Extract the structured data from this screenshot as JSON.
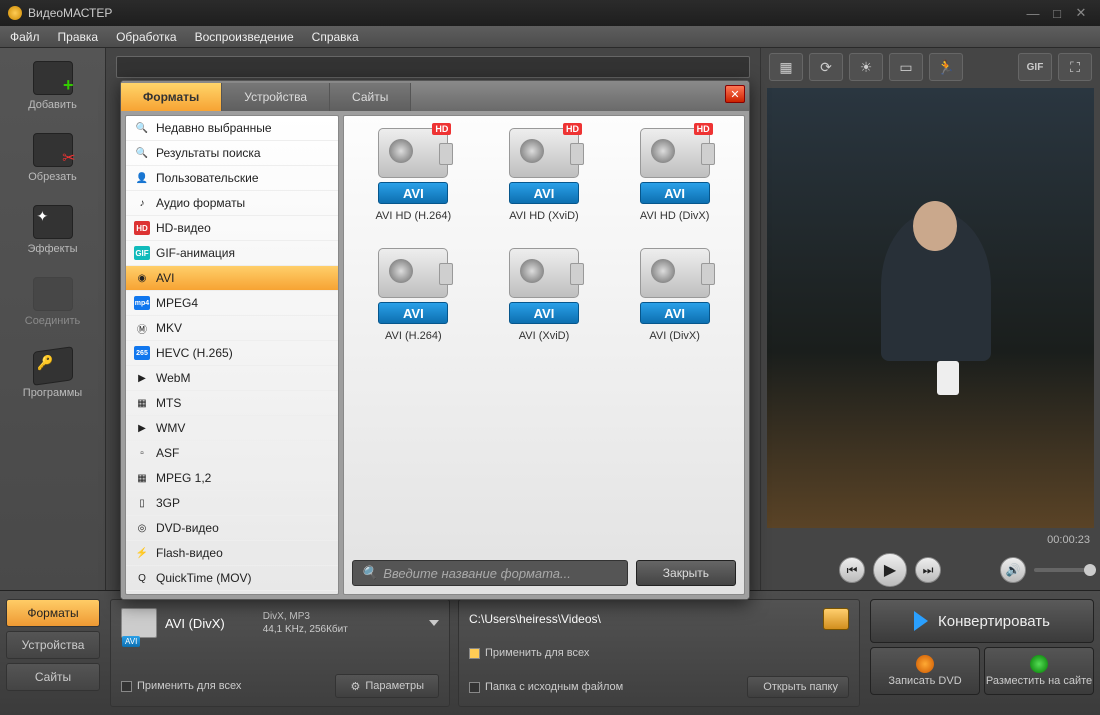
{
  "appTitle": "ВидеоМАСТЕР",
  "menu": [
    "Файл",
    "Правка",
    "Обработка",
    "Воспроизведение",
    "Справка"
  ],
  "sidebar": [
    {
      "label": "Добавить"
    },
    {
      "label": "Обрезать"
    },
    {
      "label": "Эффекты"
    },
    {
      "label": "Соединить"
    },
    {
      "label": "Программы"
    }
  ],
  "preview": {
    "time": "00:00:23",
    "gifLabel": "GIF"
  },
  "bottomTabs": [
    "Форматы",
    "Устройства",
    "Сайты"
  ],
  "codec": {
    "name": "AVI (DivX)",
    "tag": "AVI",
    "line1": "DivX, MP3",
    "line2": "44,1 KHz, 256Кбит",
    "applyAll": "Применить для всех",
    "params": "Параметры"
  },
  "pathBox": {
    "path": "C:\\Users\\heiress\\Videos\\",
    "applyAll": "Применить для всех",
    "sourceFolder": "Папка с исходным файлом",
    "openFolder": "Открыть папку"
  },
  "actions": {
    "convert": "Конвертировать",
    "dvd": "Записать DVD",
    "web": "Разместить на сайте"
  },
  "modal": {
    "tabs": [
      "Форматы",
      "Устройства",
      "Сайты"
    ],
    "closeBtn": "Закрыть",
    "searchPlaceholder": "Введите название формата...",
    "categories": [
      {
        "icon": "🔍",
        "label": "Недавно выбранные"
      },
      {
        "icon": "🔍",
        "label": "Результаты поиска"
      },
      {
        "icon": "👤",
        "label": "Пользовательские"
      },
      {
        "icon": "♪",
        "label": "Аудио форматы"
      },
      {
        "icon": "HD",
        "label": "HD-видео",
        "badge": "red"
      },
      {
        "icon": "GIF",
        "label": "GIF-анимация",
        "badge": "teal"
      },
      {
        "icon": "◉",
        "label": "AVI",
        "selected": true
      },
      {
        "icon": "mp4",
        "label": "MPEG4",
        "badge": "blue"
      },
      {
        "icon": "Ⓜ",
        "label": "MKV"
      },
      {
        "icon": "265",
        "label": "HEVC (H.265)",
        "badge": "blue"
      },
      {
        "icon": "▶",
        "label": "WebM"
      },
      {
        "icon": "▦",
        "label": "MTS"
      },
      {
        "icon": "▶",
        "label": "WMV"
      },
      {
        "icon": "▫",
        "label": "ASF"
      },
      {
        "icon": "▦",
        "label": "MPEG 1,2"
      },
      {
        "icon": "▯",
        "label": "3GP"
      },
      {
        "icon": "◎",
        "label": "DVD-видео"
      },
      {
        "icon": "⚡",
        "label": "Flash-видео"
      },
      {
        "icon": "Q",
        "label": "QuickTime (MOV)"
      }
    ],
    "cards": [
      {
        "tag": "AVI",
        "label": "AVI HD (H.264)",
        "hd": true
      },
      {
        "tag": "AVI",
        "label": "AVI HD (XviD)",
        "hd": true
      },
      {
        "tag": "AVI",
        "label": "AVI HD (DivX)",
        "hd": true
      },
      {
        "tag": "AVI",
        "label": "AVI (H.264)"
      },
      {
        "tag": "AVI",
        "label": "AVI (XviD)"
      },
      {
        "tag": "AVI",
        "label": "AVI (DivX)"
      }
    ]
  }
}
